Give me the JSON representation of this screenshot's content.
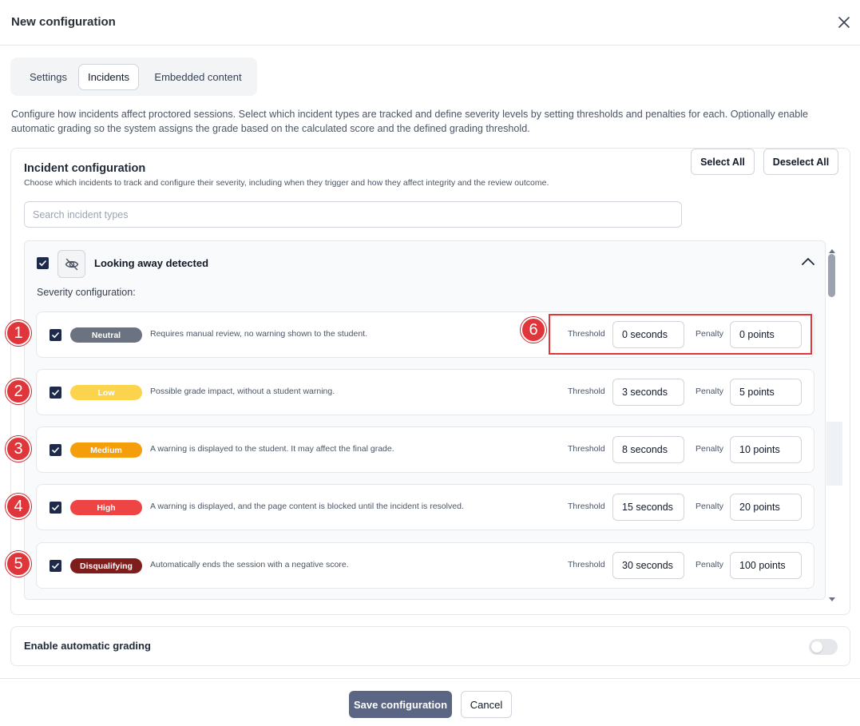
{
  "dialog": {
    "title": "New configuration",
    "close_icon": "close-icon"
  },
  "tabs": [
    {
      "label": "Settings",
      "active": false
    },
    {
      "label": "Incidents",
      "active": true
    },
    {
      "label": "Embedded content",
      "active": false
    }
  ],
  "intro": "Configure how incidents affect proctored sessions. Select which incident types are tracked and define severity levels by setting thresholds and penalties for each. Optionally enable automatic grading so the system assigns the grade based on the calculated score and the defined grading threshold.",
  "incident_config": {
    "title": "Incident configuration",
    "subtitle": "Choose which incidents to track and configure their severity, including when they trigger and how they affect integrity and the review outcome.",
    "search_placeholder": "Search incident types",
    "select_all": "Select All",
    "deselect_all": "Deselect All",
    "incident": {
      "name": "Looking away detected",
      "icon": "eye-off-icon",
      "checked": true,
      "severity_label": "Severity configuration:",
      "levels": [
        {
          "level": "Neutral",
          "description": "Requires manual review, no warning shown to the student.",
          "threshold_label": "Threshold",
          "threshold": "0 seconds",
          "penalty_label": "Penalty",
          "penalty": "0 points",
          "color": "#6b7280",
          "text_color": "#ffffff"
        },
        {
          "level": "Low",
          "description": "Possible grade impact, without a student warning.",
          "threshold_label": "Threshold",
          "threshold": "3 seconds",
          "penalty_label": "Penalty",
          "penalty": "5 points",
          "color": "#fcd34d",
          "text_color": "#ffffff"
        },
        {
          "level": "Medium",
          "description": "A warning is displayed to the student. It may affect the final grade.",
          "threshold_label": "Threshold",
          "threshold": "8 seconds",
          "penalty_label": "Penalty",
          "penalty": "10 points",
          "color": "#f59e0b",
          "text_color": "#ffffff"
        },
        {
          "level": "High",
          "description": "A warning is displayed, and the page content is blocked until the incident is resolved.",
          "threshold_label": "Threshold",
          "threshold": "15 seconds",
          "penalty_label": "Penalty",
          "penalty": "20 points",
          "color": "#ef4444",
          "text_color": "#ffffff"
        },
        {
          "level": "Disqualifying",
          "description": "Automatically ends the session with a negative score.",
          "threshold_label": "Threshold",
          "threshold": "30 seconds",
          "penalty_label": "Penalty",
          "penalty": "100 points",
          "color": "#7f1d1d",
          "text_color": "#ffffff"
        }
      ]
    }
  },
  "annotations": {
    "markers": [
      "1",
      "2",
      "3",
      "4",
      "5",
      "6"
    ],
    "marker_color": "#e0353a"
  },
  "grading": {
    "label": "Enable automatic grading",
    "enabled": false
  },
  "footer": {
    "save": "Save configuration",
    "cancel": "Cancel"
  }
}
